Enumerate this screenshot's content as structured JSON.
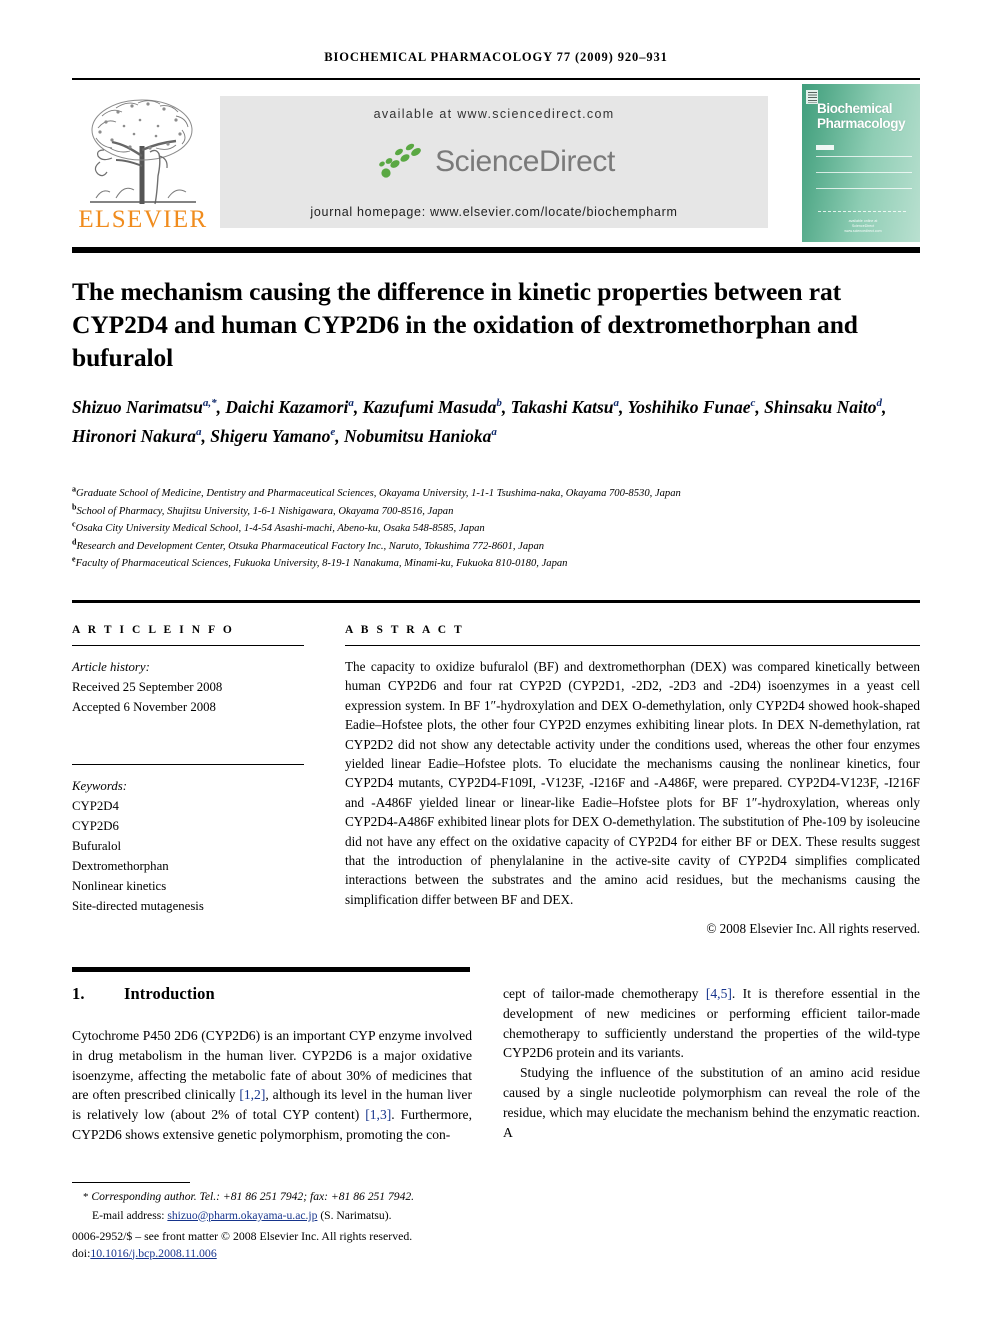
{
  "running_head": "BIOCHEMICAL PHARMACOLOGY 77 (2009) 920–931",
  "masthead": {
    "publisher_word": "ELSEVIER",
    "available_at": "available at www.sciencedirect.com",
    "sciencedirect_wordmark": "ScienceDirect",
    "journal_homepage": "journal homepage: www.elsevier.com/locate/biochempharm",
    "cover_title_line1": "Biochemical",
    "cover_title_line2": "Pharmacology",
    "cover_footer": "available online at\nScienceDirect\nwww.sciencedirect.com",
    "accent_orange": "#F08C1E",
    "cover_green": "#3f9e7c",
    "banner_gray": "#e6e6e6"
  },
  "title": "The mechanism causing the difference in kinetic properties between rat CYP2D4 and human CYP2D6 in the oxidation of dextromethorphan and bufuralol",
  "authors": [
    {
      "name": "Shizuo Narimatsu",
      "sup": "a,*"
    },
    {
      "name": "Daichi Kazamori",
      "sup": "a"
    },
    {
      "name": "Kazufumi Masuda",
      "sup": "b"
    },
    {
      "name": "Takashi Katsu",
      "sup": "a"
    },
    {
      "name": "Yoshihiko Funae",
      "sup": "c"
    },
    {
      "name": "Shinsaku Naito",
      "sup": "d"
    },
    {
      "name": "Hironori Nakura",
      "sup": "a"
    },
    {
      "name": "Shigeru Yamano",
      "sup": "e"
    },
    {
      "name": "Nobumitsu Hanioka",
      "sup": "a"
    }
  ],
  "affiliations": [
    {
      "marker": "a",
      "text": "Graduate School of Medicine, Dentistry and Pharmaceutical Sciences, Okayama University, 1-1-1 Tsushima-naka, Okayama 700-8530, Japan"
    },
    {
      "marker": "b",
      "text": "School of Pharmacy, Shujitsu University, 1-6-1 Nishigawara, Okayama 700-8516, Japan"
    },
    {
      "marker": "c",
      "text": "Osaka City University Medical School, 1-4-54 Asashi-machi, Abeno-ku, Osaka 548-8585, Japan"
    },
    {
      "marker": "d",
      "text": "Research and Development Center, Otsuka Pharmaceutical Factory Inc., Naruto, Tokushima 772-8601, Japan"
    },
    {
      "marker": "e",
      "text": "Faculty of Pharmaceutical Sciences, Fukuoka University, 8-19-1 Nanakuma, Minami-ku, Fukuoka 810-0180, Japan"
    }
  ],
  "article_info": {
    "heading": "A R T I C L E   I N F O",
    "history_label": "Article history:",
    "received": "Received 25 September 2008",
    "accepted": "Accepted 6 November 2008",
    "keywords_label": "Keywords:",
    "keywords": [
      "CYP2D4",
      "CYP2D6",
      "Bufuralol",
      "Dextromethorphan",
      "Nonlinear kinetics",
      "Site-directed mutagenesis"
    ]
  },
  "abstract": {
    "heading": "A B S T R A C T",
    "text": "The capacity to oxidize bufuralol (BF) and dextromethorphan (DEX) was compared kinetically between human CYP2D6 and four rat CYP2D (CYP2D1, -2D2, -2D3 and -2D4) isoenzymes in a yeast cell expression system. In BF 1″-hydroxylation and DEX O-demethylation, only CYP2D4 showed hook-shaped Eadie–Hofstee plots, the other four CYP2D enzymes exhibiting linear plots. In DEX N-demethylation, rat CYP2D2 did not show any detectable activity under the conditions used, whereas the other four enzymes yielded linear Eadie–Hofstee plots. To elucidate the mechanisms causing the nonlinear kinetics, four CYP2D4 mutants, CYP2D4-F109I, -V123F, -I216F and -A486F, were prepared. CYP2D4-V123F, -I216F and -A486F yielded linear or linear-like Eadie–Hofstee plots for BF 1″-hydroxylation, whereas only CYP2D4-A486F exhibited linear plots for DEX O-demethylation. The substitution of Phe-109 by isoleucine did not have any effect on the oxidative capacity of CYP2D4 for either BF or DEX. These results suggest that the introduction of phenylalanine in the active-site cavity of CYP2D4 simplifies complicated interactions between the substrates and the amino acid residues, but the mechanisms causing the simplification differ between BF and DEX.",
    "copyright": "© 2008 Elsevier Inc. All rights reserved."
  },
  "body": {
    "section_number": "1.",
    "section_title": "Introduction",
    "left_paragraph_1_pre": "Cytochrome P450 2D6 (CYP2D6) is an important CYP enzyme involved in drug metabolism in the human liver. CYP2D6 is a major oxidative isoenzyme, affecting the metabolic fate of about 30% of medicines that are often prescribed clinically ",
    "ref_1_2": "[1,2]",
    "left_paragraph_1_mid": ", although its level in the human liver is relatively low (about 2% of total CYP content) ",
    "ref_1_3": "[1,3]",
    "left_paragraph_1_post": ". Furthermore, CYP2D6 shows extensive genetic polymorphism, promoting the con-",
    "right_paragraph_1_pre": "cept of tailor-made chemotherapy ",
    "ref_4_5": "[4,5]",
    "right_paragraph_1_post": ". It is therefore essential in the development of new medicines or performing efficient tailor-made chemotherapy to sufficiently understand the properties of the wild-type CYP2D6 protein and its variants.",
    "right_paragraph_2": "Studying the influence of the substitution of an amino acid residue caused by a single nucleotide polymorphism can reveal the role of the residue, which may elucidate the mechanism behind the enzymatic reaction. A"
  },
  "footer": {
    "corresponding_star": "*",
    "corresponding_author": "Corresponding author. Tel.: +81 86 251 7942; fax: +81 86 251 7942.",
    "email_label": "E-mail address: ",
    "email": "shizuo@pharm.okayama-u.ac.jp",
    "email_suffix": " (S. Narimatsu).",
    "front_matter": "0006-2952/$ – see front matter © 2008 Elsevier Inc. All rights reserved.",
    "doi_label": "doi:",
    "doi": "10.1016/j.bcp.2008.11.006",
    "link_color": "#16348c"
  }
}
